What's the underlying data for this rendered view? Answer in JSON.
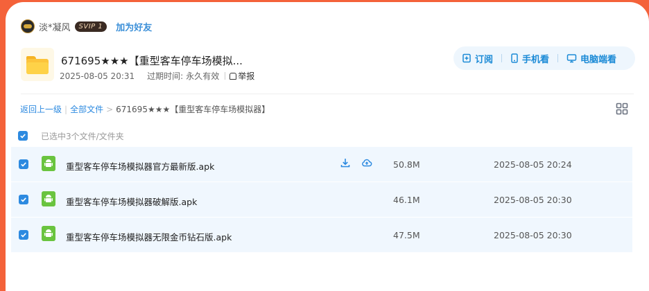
{
  "user": {
    "name": "淡*凝风",
    "badge": "SVIP 1",
    "add_friend": "加为好友"
  },
  "share": {
    "title": "671695★★★【重型客车停车场模拟...",
    "date": "2025-08-05 20:31",
    "expire_label": "过期时间:",
    "expire_value": "永久有效",
    "report": "举报"
  },
  "actions": {
    "subscribe": "订阅",
    "mobile": "手机看",
    "pc": "电脑端看"
  },
  "breadcrumb": {
    "back": "返回上一级",
    "all": "全部文件",
    "sep": ">",
    "current": "671695★★★【重型客车停车场模拟器】"
  },
  "selection": {
    "text": "已选中3个文件/文件夹"
  },
  "files": [
    {
      "name": "重型客车停车场模拟器官方最新版.apk",
      "size": "50.8M",
      "date": "2025-08-05 20:24"
    },
    {
      "name": "重型客车停车场模拟器破解版.apk",
      "size": "46.1M",
      "date": "2025-08-05 20:30"
    },
    {
      "name": "重型客车停车场模拟器无限金币钻石版.apk",
      "size": "47.5M",
      "date": "2025-08-05 20:30"
    }
  ],
  "colors": {
    "accent": "#2d8ae0",
    "page_bg": "#f4623a",
    "row_bg": "#f0f7fe",
    "apk_green": "#6ac43f",
    "folder_yellow": "#fcc43b"
  },
  "icons": {
    "avatar": "avatar",
    "folder": "folder-icon",
    "report": "report-icon",
    "subscribe": "bookmark-icon",
    "mobile": "phone-icon",
    "pc": "monitor-icon",
    "grid": "grid-view-icon",
    "checkbox": "checkbox-checked-icon",
    "apk": "android-icon",
    "download": "download-icon",
    "save": "cloud-save-icon"
  }
}
